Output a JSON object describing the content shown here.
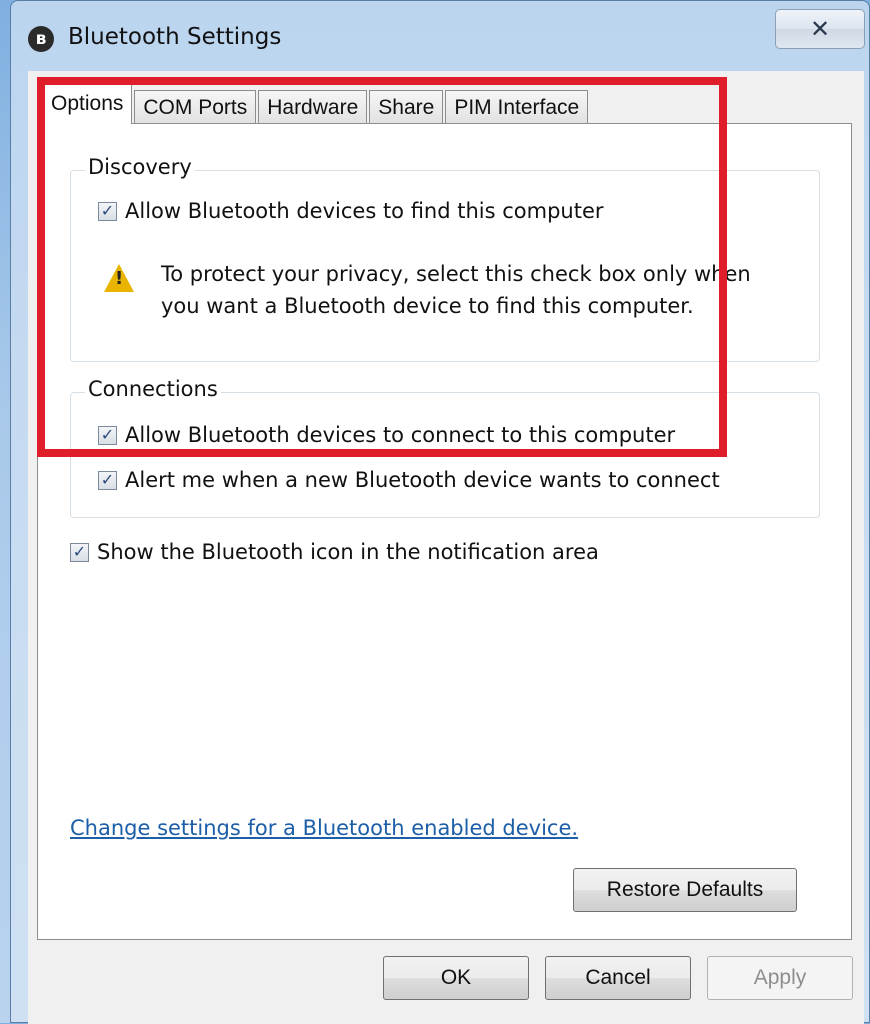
{
  "window": {
    "title": "Bluetooth Settings",
    "close_glyph": "✕",
    "bluetooth_glyph": "ʙ"
  },
  "tabs": [
    {
      "label": "Options",
      "active": true
    },
    {
      "label": "COM Ports",
      "active": false
    },
    {
      "label": "Hardware",
      "active": false
    },
    {
      "label": "Share",
      "active": false
    },
    {
      "label": "PIM Interface",
      "active": false
    }
  ],
  "discovery": {
    "title": "Discovery",
    "allow_find": {
      "label": "Allow Bluetooth devices to find this computer",
      "checked": true
    },
    "warning_line1": "To protect your privacy, select this check box only when",
    "warning_line2": "you want a Bluetooth device to find this computer.",
    "warning_icon": "warning-triangle"
  },
  "connections": {
    "title": "Connections",
    "allow_connect": {
      "label": "Allow Bluetooth devices to connect to this computer",
      "checked": true
    },
    "alert_new": {
      "label": "Alert me when a new Bluetooth device wants to connect",
      "checked": true
    }
  },
  "show_icon": {
    "label": "Show the Bluetooth icon in the notification area",
    "checked": true
  },
  "link_text": "Change settings for a Bluetooth enabled device.",
  "buttons": {
    "restore_defaults": "Restore Defaults",
    "ok": "OK",
    "cancel": "Cancel",
    "apply": "Apply"
  },
  "check_glyph": "✓",
  "colors": {
    "highlight": "#e01e2a",
    "link": "#1d5ea8",
    "warning": "#e8b400"
  }
}
